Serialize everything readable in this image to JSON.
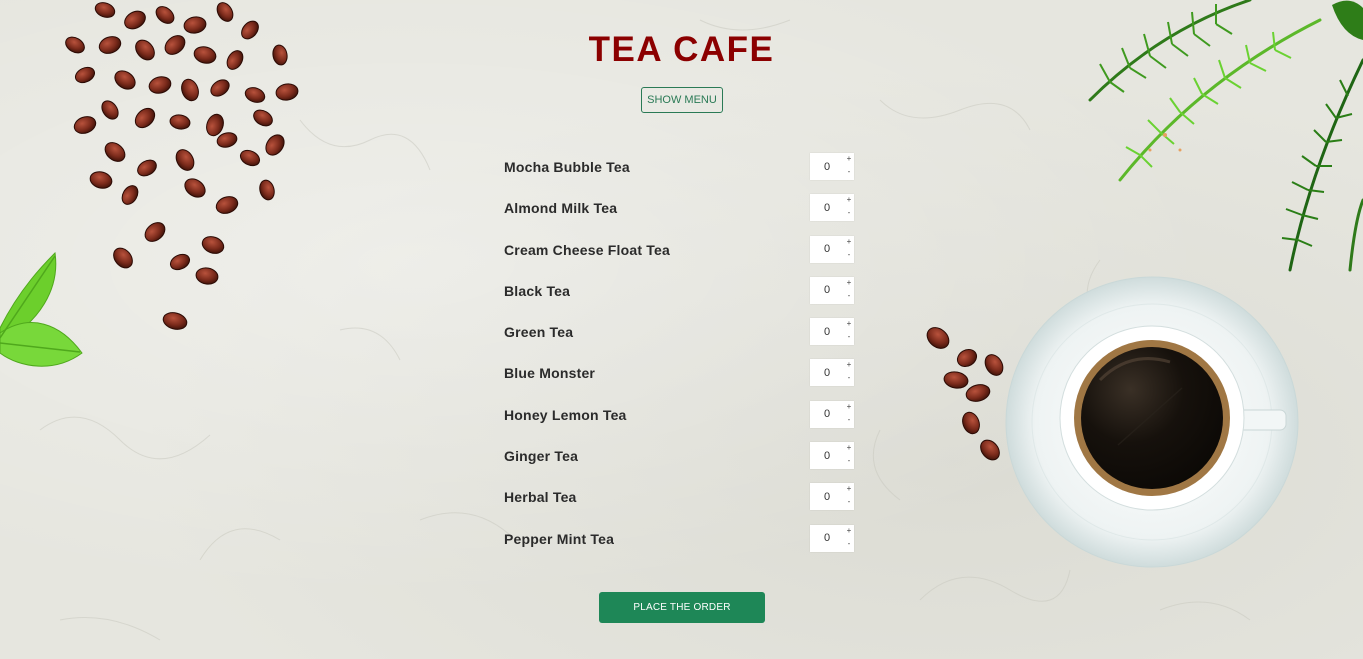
{
  "header": {
    "title": "TEA CAFE",
    "show_menu_label": "SHOW MENU"
  },
  "menu": {
    "items": [
      {
        "name": "Mocha Bubble Tea",
        "quantity": "0"
      },
      {
        "name": "Almond Milk Tea",
        "quantity": "0"
      },
      {
        "name": "Cream Cheese Float Tea",
        "quantity": "0"
      },
      {
        "name": "Black Tea",
        "quantity": "0"
      },
      {
        "name": "Green Tea",
        "quantity": "0"
      },
      {
        "name": "Blue Monster",
        "quantity": "0"
      },
      {
        "name": "Honey Lemon Tea",
        "quantity": "0"
      },
      {
        "name": "Ginger Tea",
        "quantity": "0"
      },
      {
        "name": "Herbal Tea",
        "quantity": "0"
      },
      {
        "name": "Pepper Mint Tea",
        "quantity": "0"
      }
    ],
    "increment_symbol": "+",
    "decrement_symbol": "-"
  },
  "order": {
    "place_order_label": "PLACE THE ORDER"
  },
  "colors": {
    "title": "#8b0000",
    "accent_green": "#1e8757",
    "outline_green": "#2a7a55",
    "background": "#e6e6df"
  },
  "decorations": [
    "coffee-beans-image",
    "green-leaf-image",
    "fern-leaves-image",
    "coffee-cup-image"
  ]
}
